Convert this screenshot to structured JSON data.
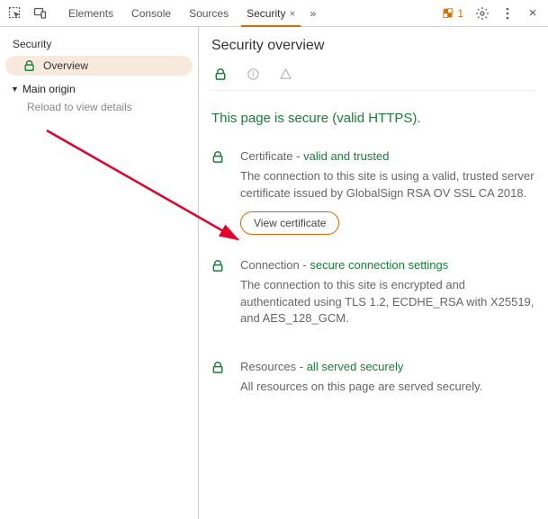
{
  "toolbar": {
    "tabs": {
      "elements": "Elements",
      "console": "Console",
      "sources": "Sources",
      "security": "Security"
    },
    "more": "»",
    "issue_count": "1"
  },
  "sidebar": {
    "heading": "Security",
    "overview": "Overview",
    "main_origin": "Main origin",
    "reload_hint": "Reload to view details"
  },
  "content": {
    "title": "Security overview",
    "headline": "This page is secure (valid HTTPS).",
    "certificate": {
      "label": "Certificate",
      "status": "valid and trusted",
      "sep": " - ",
      "desc": "The connection to this site is using a valid, trusted server certificate issued by GlobalSign RSA OV SSL CA 2018.",
      "button": "View certificate"
    },
    "connection": {
      "label": "Connection",
      "status": "secure connection settings",
      "sep": " - ",
      "desc": "The connection to this site is encrypted and authenticated using TLS 1.2, ECDHE_RSA with X25519, and AES_128_GCM."
    },
    "resources": {
      "label": "Resources",
      "status": "all served securely",
      "sep": " - ",
      "desc": "All resources on this page are served securely."
    }
  }
}
